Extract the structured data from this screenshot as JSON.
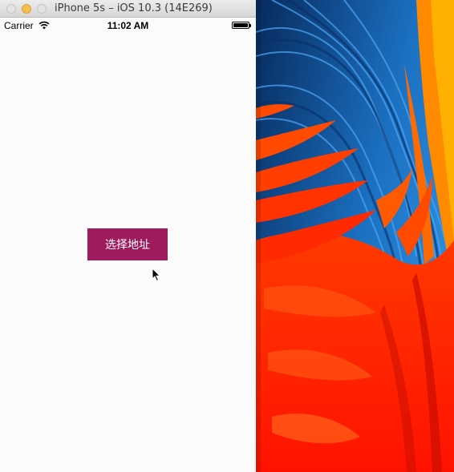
{
  "window": {
    "title": "iPhone 5s – iOS 10.3 (14E269)"
  },
  "status_bar": {
    "carrier": "Carrier",
    "time": "11:02 AM"
  },
  "main": {
    "select_address_label": "选择地址"
  },
  "colors": {
    "button": "#9e1b5e",
    "wallpaper_blue": "#0b3b78",
    "wallpaper_red": "#ff1a00",
    "wallpaper_orange": "#ff7a00"
  },
  "icons": [
    "wifi-icon",
    "battery-icon",
    "cursor-icon"
  ]
}
